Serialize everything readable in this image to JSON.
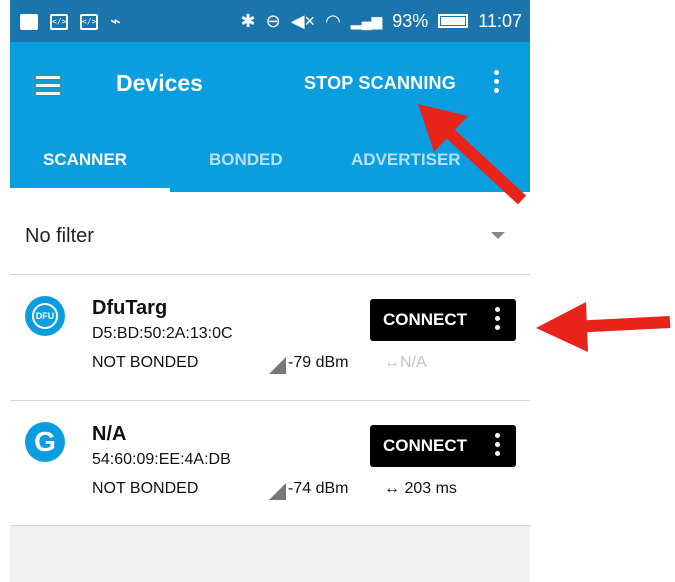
{
  "status_bar": {
    "battery_percent": "93%",
    "time": "11:07",
    "icons": [
      "mail-icon",
      "code-icon",
      "code-icon",
      "usb-icon",
      "bluetooth-icon",
      "do-not-disturb-icon",
      "mute-icon",
      "wifi-icon",
      "signal-icon",
      "battery-icon"
    ]
  },
  "app_bar": {
    "title": "Devices",
    "stop_scanning_label": "STOP SCANNING",
    "menu_icon": "hamburger-menu-icon",
    "overflow_icon": "vertical-dots-icon"
  },
  "tabs": [
    {
      "label": "SCANNER",
      "active": true
    },
    {
      "label": "BONDED",
      "active": false
    },
    {
      "label": "ADVERTISER",
      "active": false
    }
  ],
  "filter": {
    "label": "No filter"
  },
  "devices": [
    {
      "avatar_label": "DFU",
      "name": "DfuTarg",
      "address": "D5:BD:50:2A:13:0C",
      "bond_state": "NOT BONDED",
      "rssi": "-79 dBm",
      "interval": "↔N/A",
      "connect_label": "CONNECT"
    },
    {
      "avatar_label": "G",
      "name": "N/A",
      "address": "54:60:09:EE:4A:DB",
      "bond_state": "NOT BONDED",
      "rssi": "-74 dBm",
      "interval": "↔ 203 ms",
      "connect_label": "CONNECT"
    }
  ],
  "colors": {
    "status_bar": "#1b74ab",
    "app_bar": "#0a9ee0",
    "annotation_arrow": "#e8231a",
    "connect_button": "#000000"
  }
}
